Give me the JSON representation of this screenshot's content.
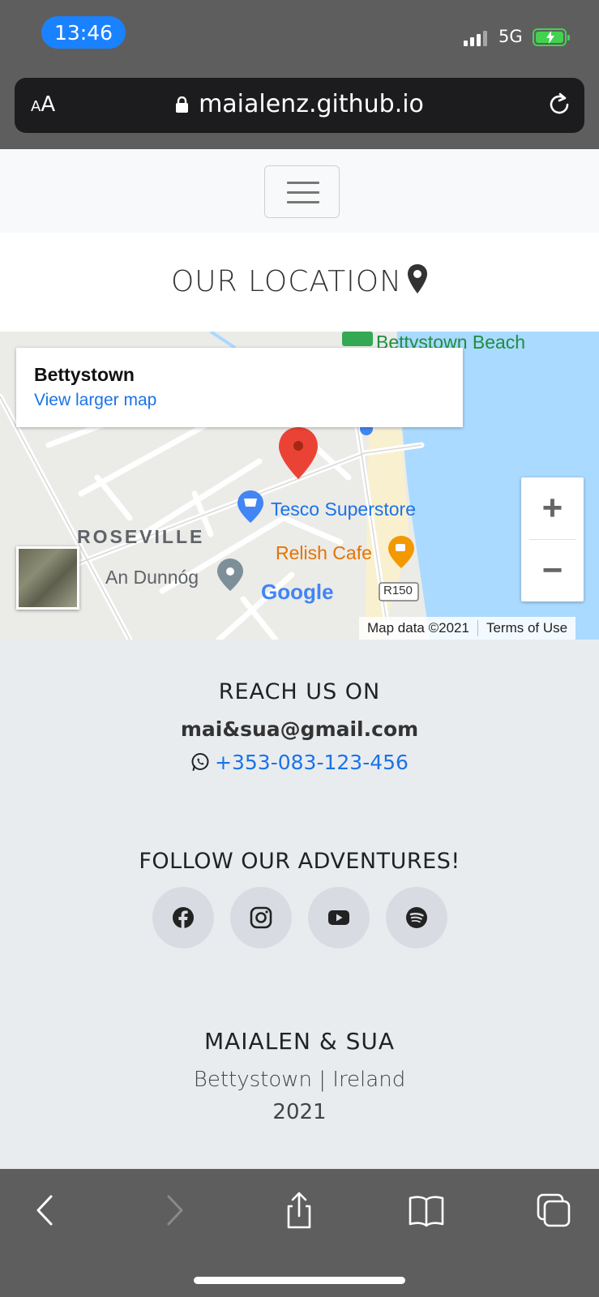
{
  "status_bar": {
    "time": "13:46",
    "network": "5G",
    "battery": "charging"
  },
  "browser": {
    "text_size_label_small": "A",
    "text_size_label_large": "A",
    "url": "maialenz.github.io"
  },
  "location": {
    "title": "OUR LOCATION"
  },
  "map": {
    "place_name": "Bettystown",
    "larger_map_link": "View larger map",
    "labels": {
      "beach": "Bettystown Beach",
      "tesco": "Tesco Superstore",
      "relish": "Relish Cafe",
      "roseville": "ROSEVILLE",
      "dunnog": "An Dunnóg",
      "road": "R150",
      "google": "Google"
    },
    "zoom_in": "+",
    "zoom_out": "−",
    "map_data": "Map data ©2021",
    "terms": "Terms of Use"
  },
  "contact": {
    "title": "REACH US ON",
    "email": "mai&sua@gmail.com",
    "phone": "+353-083-123-456"
  },
  "social": {
    "title": "FOLLOW OUR ADVENTURES!",
    "links": [
      "facebook-icon",
      "instagram-icon",
      "youtube-icon",
      "spotify-icon"
    ]
  },
  "footer": {
    "brand": "MAIALEN & SUA",
    "place": "Bettystown | Ireland",
    "year": "2021"
  },
  "colors": {
    "link": "#1a73e8",
    "time_pill": "#1a82ff",
    "battery": "#42d24f",
    "footer_bg": "#e9ecef"
  }
}
